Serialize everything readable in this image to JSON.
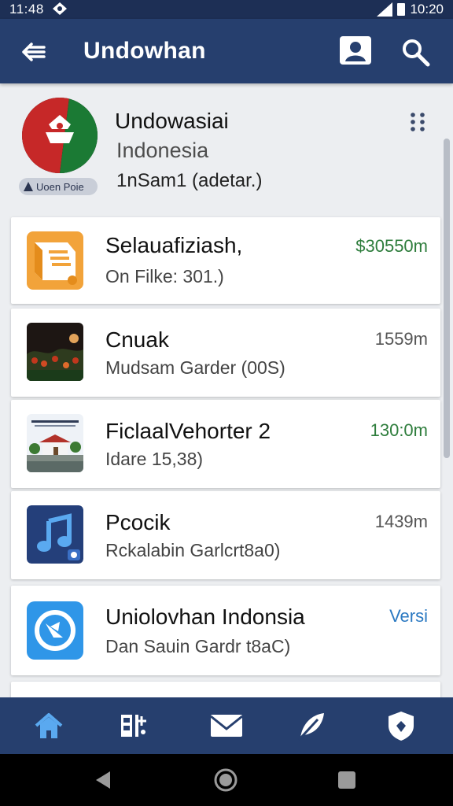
{
  "status_bar": {
    "time": "11:48",
    "clock_right": "10:20"
  },
  "app_bar": {
    "title": "Undowhan"
  },
  "profile": {
    "name": "Undowasiai",
    "country": "Indonesia",
    "subtitle": "1nSam1 (adetar.)",
    "badge": "Uoen Poie"
  },
  "list": [
    {
      "title": "Selauafiziash,",
      "subtitle": "On Filke: 301.)",
      "value": "$30550m",
      "value_color": "#2e7d3c",
      "icon": "document-folder-icon"
    },
    {
      "title": "Cnuak",
      "subtitle": "Mudsam Garder (00S)",
      "value": "1559m",
      "value_color": "#555555",
      "icon": "night-garden-photo"
    },
    {
      "title": "FiclaalVehorter 2",
      "subtitle": "Idare 15,38)",
      "value": "130:0m",
      "value_color": "#2e7d3c",
      "icon": "house-photo"
    },
    {
      "title": "Pcocik",
      "subtitle": "Rckalabin Garlcrt8a0)",
      "value": "1439m",
      "value_color": "#555555",
      "icon": "music-note-icon"
    },
    {
      "title": "Uniolovhan Indonsia",
      "subtitle": "Dan Sauin Gardr t8aC)",
      "value": "Versi",
      "value_color": "#2b79c2",
      "icon": "app-store-icon"
    }
  ],
  "bottom_nav": [
    "home-icon",
    "apps-icon",
    "mail-icon",
    "feather-icon",
    "shield-icon"
  ],
  "colors": {
    "primary": "#263f6e",
    "status_bar": "#1d2f55",
    "accent_green": "#2e7d3c",
    "accent_blue": "#2b79c2"
  }
}
